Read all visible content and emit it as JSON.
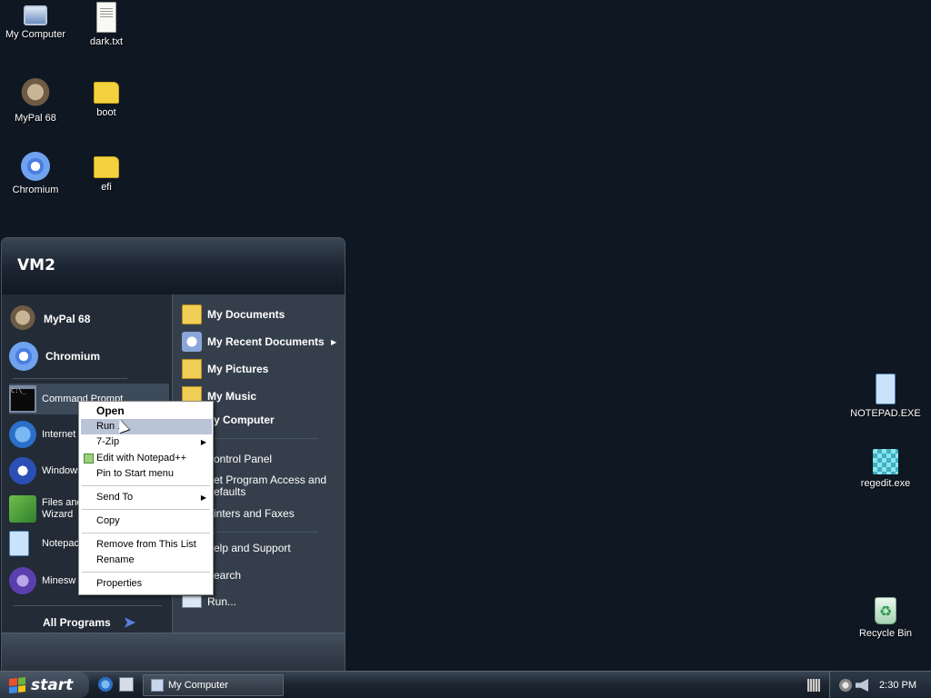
{
  "desktop": {
    "icons": {
      "my_computer": "My Computer",
      "dark_txt": "dark.txt",
      "mypal": "MyPal 68",
      "boot": "boot",
      "chromium": "Chromium",
      "efi": "efi",
      "notepad_exe": "NOTEPAD.EXE",
      "regedit_exe": "regedit.exe",
      "recycle_bin": "Recycle Bin"
    }
  },
  "start_menu": {
    "user": "VM2",
    "pinned": [
      "MyPal 68",
      "Chromium"
    ],
    "recent": [
      "Command Prompt",
      "Internet",
      "Windows",
      "Files and\nWizard",
      "Notepad",
      "Minesw"
    ],
    "all_programs": "All Programs",
    "right": {
      "my_documents": "My Documents",
      "my_recent_documents": "My Recent Documents",
      "my_pictures": "My Pictures",
      "my_music": "My Music",
      "my_computer": "y Computer",
      "control_panel": "ontrol Panel",
      "program_access_1": "et Program Access and",
      "program_access_2": "efaults",
      "printers": "inters and Faxes",
      "help": "elp and Support",
      "search": "earch",
      "run": "Run..."
    }
  },
  "context_menu": {
    "open": "Open",
    "run_as": "Run   ...",
    "seven_zip": "7-Zip",
    "edit_notepadpp": "Edit with Notepad++",
    "pin": "Pin to Start menu",
    "send_to": "Send To",
    "copy": "Copy",
    "remove": "Remove from This List",
    "rename": "Rename",
    "properties": "Properties"
  },
  "taskbar": {
    "start": "start",
    "window": "My Computer",
    "clock": "2:30 PM"
  }
}
